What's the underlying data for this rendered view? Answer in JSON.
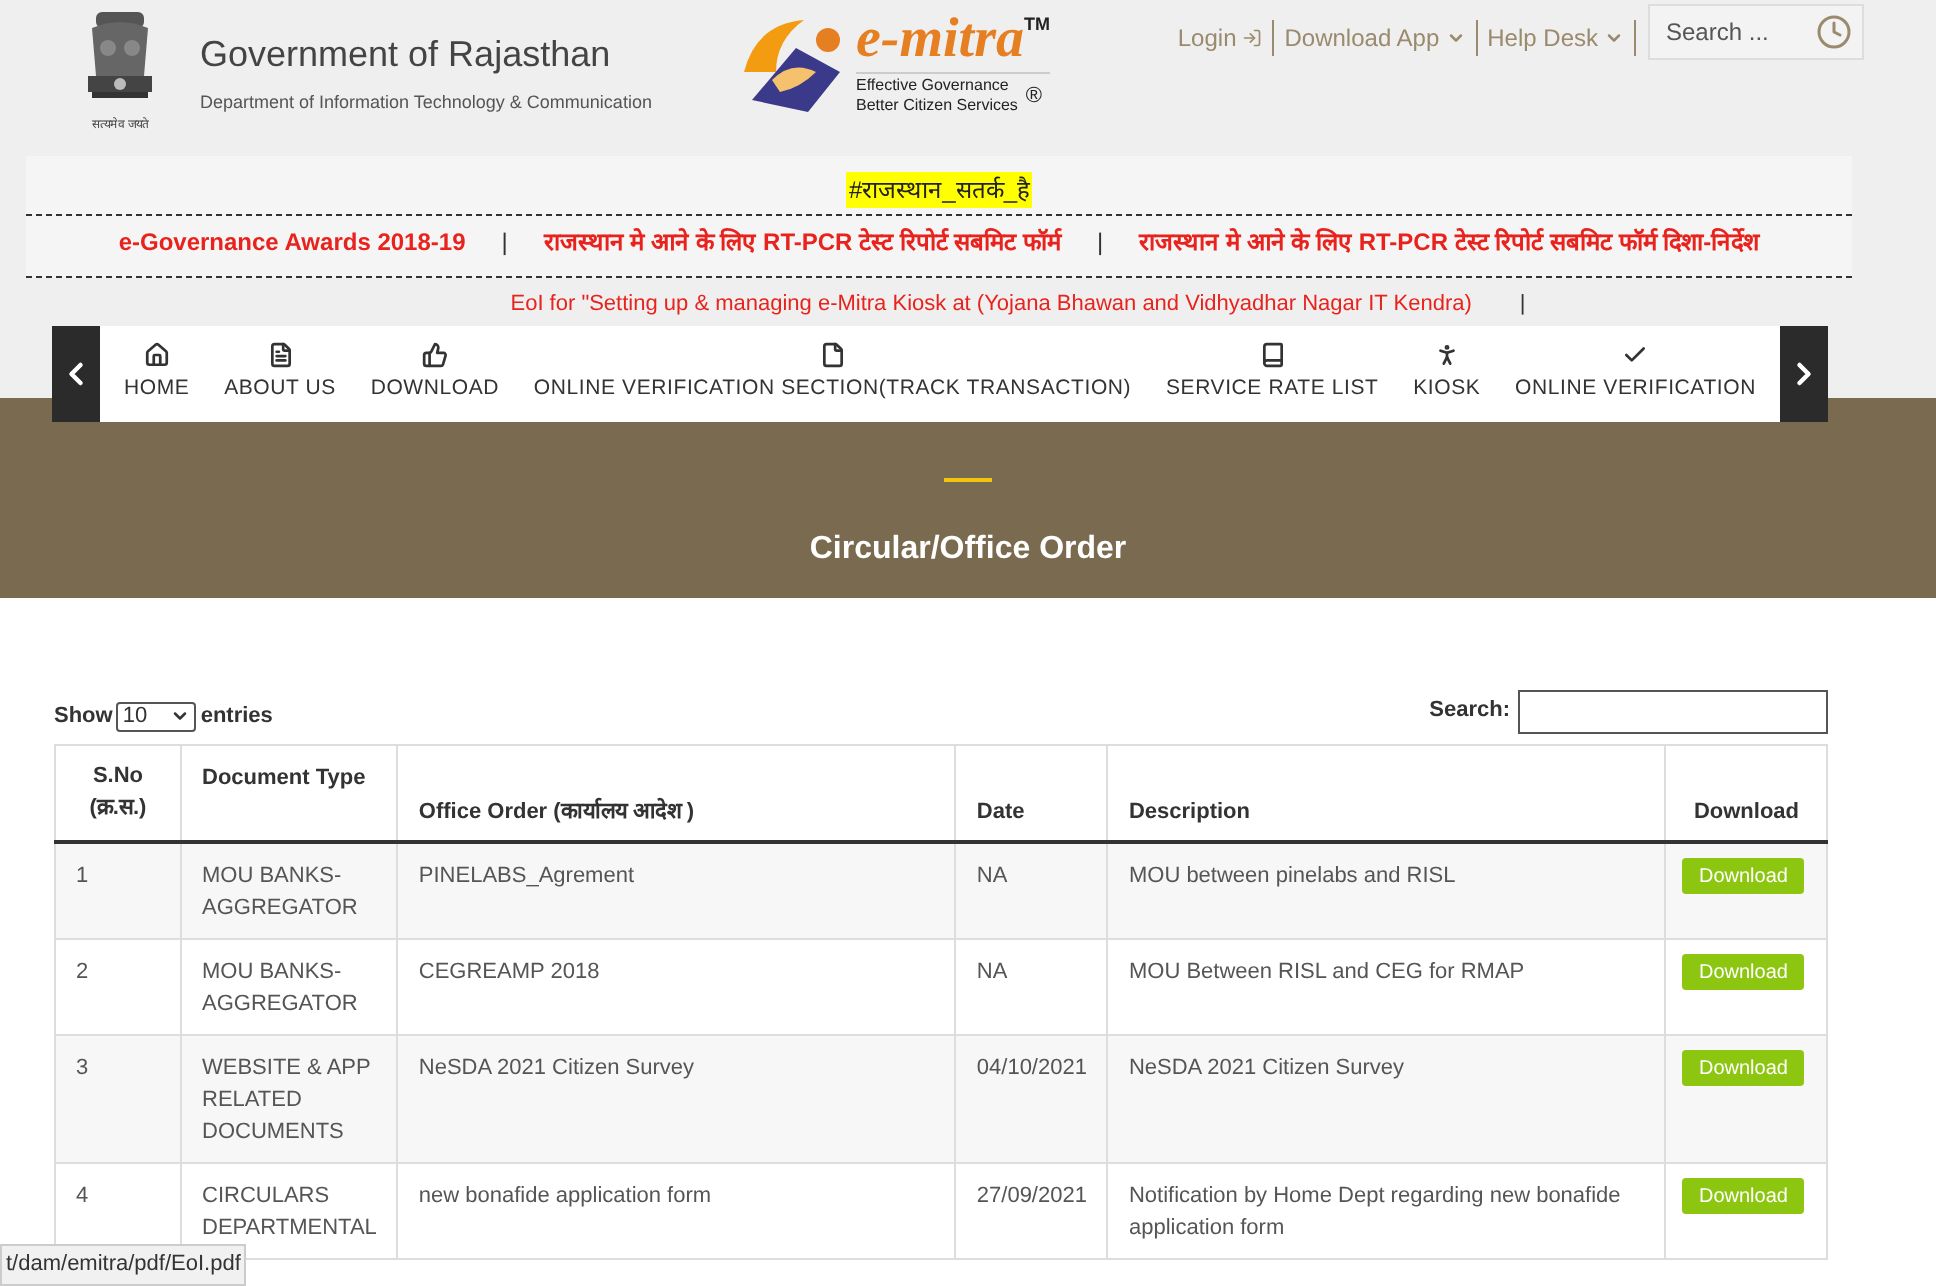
{
  "header": {
    "title": "Government of Rajasthan",
    "subtitle": "Department of Information Technology & Communication",
    "motto": "सत्यमेव जयते"
  },
  "brand": {
    "name": "e-mitra",
    "trademark": "TM",
    "tagline_1": "Effective Governance",
    "tagline_2": "Better Citizen Services",
    "registered": "®"
  },
  "top_links": [
    {
      "label": "Login",
      "kind": "login"
    },
    {
      "label": "Download App",
      "kind": "dropdown"
    },
    {
      "label": "Help Desk",
      "kind": "dropdown"
    }
  ],
  "search": {
    "placeholder": "Search ..."
  },
  "ticker": {
    "hashtag": "#राजस्थान_सतर्क_है",
    "separator": "|",
    "links": [
      "e-Governance Awards 2018-19",
      "राजस्थान मे आने के लिए RT-PCR टेस्ट रिपोर्ट सबमिट फॉर्म",
      "राजस्थान मे आने के लिए RT-PCR टेस्ट रिपोर्ट सबमिट फॉर्म दिशा-निर्देश"
    ],
    "notice": "EoI for \"Setting up & managing e-Mitra Kiosk at (Yojana Bhawan and Vidhyadhar Nagar IT Kendra)"
  },
  "nav": {
    "items": [
      {
        "label": "HOME",
        "kind": "home"
      },
      {
        "label": "ABOUT US",
        "kind": "doc"
      },
      {
        "label": "DOWNLOAD",
        "kind": "thumb"
      },
      {
        "label": "ONLINE VERIFICATION SECTION(TRACK TRANSACTION)",
        "kind": "file"
      },
      {
        "label": "SERVICE RATE LIST",
        "kind": "book"
      },
      {
        "label": "KIOSK",
        "kind": "person"
      },
      {
        "label": "ONLINE VERIFICATION",
        "kind": "check"
      }
    ]
  },
  "page_title": "Circular/Office Order",
  "table": {
    "show_label": "Show",
    "page_size": "10",
    "entries_label": "entries",
    "search_label": "Search:",
    "columns": [
      "S.No (क्र.स.)",
      "Document Type",
      "Office Order (कार्यालय आदेश )",
      "Date",
      "Description",
      "Download"
    ],
    "rows": [
      {
        "sno": "1",
        "doc_type": "MOU BANKS-AGGREGATOR",
        "office_order": "PINELABS_Agrement",
        "date": "NA",
        "description": "MOU between pinelabs and RISL",
        "action": "Download"
      },
      {
        "sno": "2",
        "doc_type": "MOU BANKS-AGGREGATOR",
        "office_order": "CEGREAMP 2018",
        "date": "NA",
        "description": "MOU Between RISL and CEG for RMAP",
        "action": "Download"
      },
      {
        "sno": "3",
        "doc_type": "WEBSITE & APP RELATED DOCUMENTS",
        "office_order": "NeSDA 2021 Citizen Survey",
        "date": "04/10/2021",
        "description": "NeSDA 2021 Citizen Survey",
        "action": "Download"
      },
      {
        "sno": "4",
        "doc_type": "CIRCULARS DEPARTMENTAL",
        "office_order": "new bonafide application form",
        "date": "27/09/2021",
        "description": "Notification by Home Dept regarding new bonafide application form",
        "action": "Download"
      }
    ]
  },
  "status_bar": "t/dam/emitra/pdf/EoI.pdf"
}
